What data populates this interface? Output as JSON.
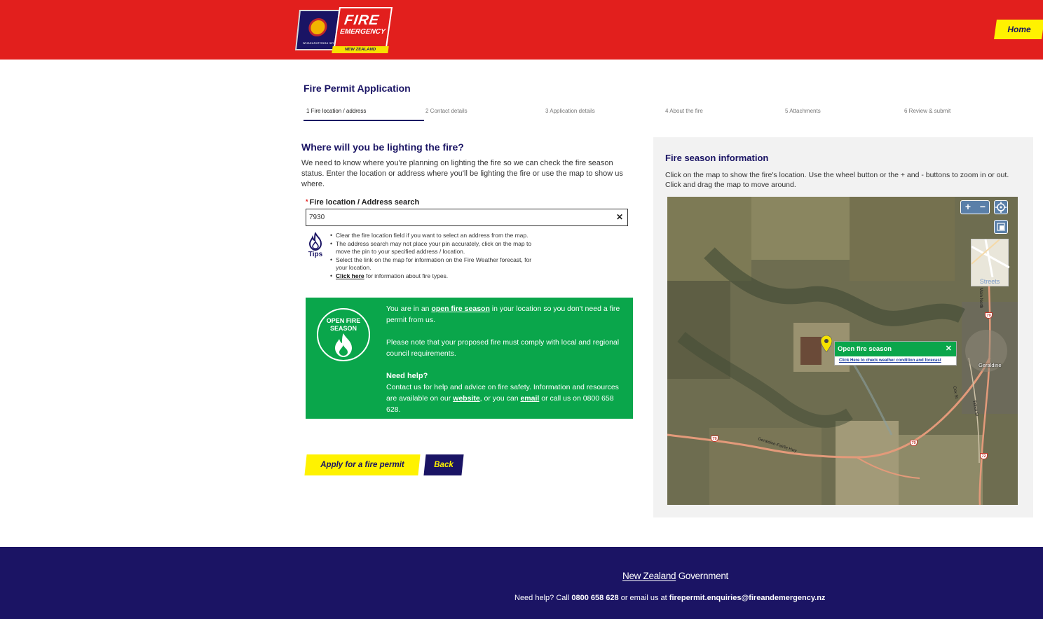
{
  "header": {
    "logo_fire": "FIRE",
    "logo_emergency": "EMERGENCY",
    "logo_nz": "NEW ZEALAND",
    "logo_badge_text": "WHAKARATONGA IWI",
    "home_label": "Home"
  },
  "page_title": "Fire Permit Application",
  "steps": [
    {
      "label": "1  Fire location / address"
    },
    {
      "label": "2  Contact details"
    },
    {
      "label": "3  Application details"
    },
    {
      "label": "4  About the fire"
    },
    {
      "label": "5  Attachments"
    },
    {
      "label": "6  Review & submit"
    }
  ],
  "question": {
    "heading": "Where will you be lighting the fire?",
    "description": "We need to know where you're planning on lighting the fire so we can check the fire season status. Enter the location or address where you'll be lighting the fire or use the map to show us where."
  },
  "search": {
    "label": "Fire location / Address search",
    "required_marker": "*",
    "value": "7930",
    "clear_label": "✕"
  },
  "tips": {
    "label": "Tips",
    "items": [
      "Clear the fire location field if you want to select an address from the map.",
      "The address search may not place your pin accurately, click on the map to move the pin to your specified address / location.",
      "Select the link on the map for information on the Fire Weather forecast, for your location."
    ],
    "link_text": "Click here",
    "link_suffix": " for information about fire types."
  },
  "status_box": {
    "badge_line1": "OPEN FIRE",
    "badge_line2": "SEASON",
    "p1_prefix": "You are in an ",
    "p1_link": "open fire season",
    "p1_suffix": " in your location so you don't need a fire permit from us.",
    "p2": "Please note that your proposed fire must comply with local and regional council requirements.",
    "help_heading": "Need help?",
    "help_prefix": "Contact us for help and advice on fire safety. Information and resources are available on our ",
    "help_link_website": "website",
    "help_middle": ", or you can ",
    "help_link_email": "email",
    "help_suffix": " or call us on 0800 658 628."
  },
  "buttons": {
    "apply": "Apply for a fire permit",
    "back": "Back"
  },
  "fire_season_panel": {
    "title": "Fire season information",
    "description": "Click on the map to show the fire's location. Use the wheel button or the + and - buttons to zoom in or out. Click and drag the map to move around."
  },
  "map": {
    "zoom_in": "+",
    "zoom_out": "−",
    "streets_label": "Streets",
    "popup_title": "Open fire season",
    "popup_close": "✕",
    "popup_link": "Click Here to check weather condition and forecast",
    "town_label": "Geraldine",
    "road_main_north": "Main North",
    "road_geraldine_fairlie": "Geraldine-Fairlie Hwy",
    "road_cox_st": "Cox St",
    "road_talbot_st": "Talbot St",
    "shield_79": "79",
    "shield_72": "72"
  },
  "footer": {
    "gov_part1": "New Zealand",
    "gov_part2": " Government",
    "help_prefix": "Need help? Call ",
    "phone": "0800 658 628",
    "help_middle": " or email us at ",
    "email": "firepermit.enquiries@fireandemergency.nz"
  },
  "colors": {
    "brand_red": "#e21f1d",
    "brand_navy": "#1a1464",
    "brand_yellow": "#fff200",
    "status_green": "#0aa64b"
  }
}
